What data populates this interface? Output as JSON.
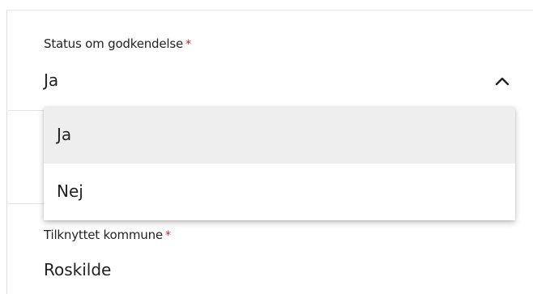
{
  "status_field": {
    "label": "Status om godkendelse",
    "required_marker": "*",
    "value": "Ja"
  },
  "dropdown": {
    "options": [
      {
        "label": "Ja",
        "highlighted": true
      },
      {
        "label": "Nej",
        "highlighted": false
      }
    ]
  },
  "kommune_field": {
    "label": "Tilknyttet kommune",
    "required_marker": "*",
    "value": "Roskilde"
  },
  "icons": {
    "dropdown_toggle": "chevron-up-icon"
  },
  "colors": {
    "required": "#d0262d",
    "highlight": "#eeeeee",
    "text": "#222222"
  }
}
